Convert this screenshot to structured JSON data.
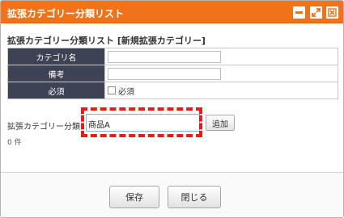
{
  "window": {
    "title": "拡張カテゴリー分類リスト",
    "accent_color": "#f0731c",
    "controls": {
      "minimize_icon": "minimize-icon",
      "maximize_icon": "maximize-icon",
      "close_icon": "close-icon"
    }
  },
  "section": {
    "subtitle": "拡張カテゴリー分類リスト [新規拡張カテゴリー]"
  },
  "form": {
    "rows": [
      {
        "label": "カテゴリ名",
        "value": ""
      },
      {
        "label": "備考",
        "value": ""
      },
      {
        "label": "必須",
        "checkbox_label": "必須",
        "checked": false
      }
    ]
  },
  "category": {
    "label": "拡張カテゴリー分類",
    "input_value": "商品A",
    "add_label": "追加",
    "count_text": "0 件"
  },
  "footer": {
    "save_label": "保存",
    "close_label": "閉じる"
  }
}
